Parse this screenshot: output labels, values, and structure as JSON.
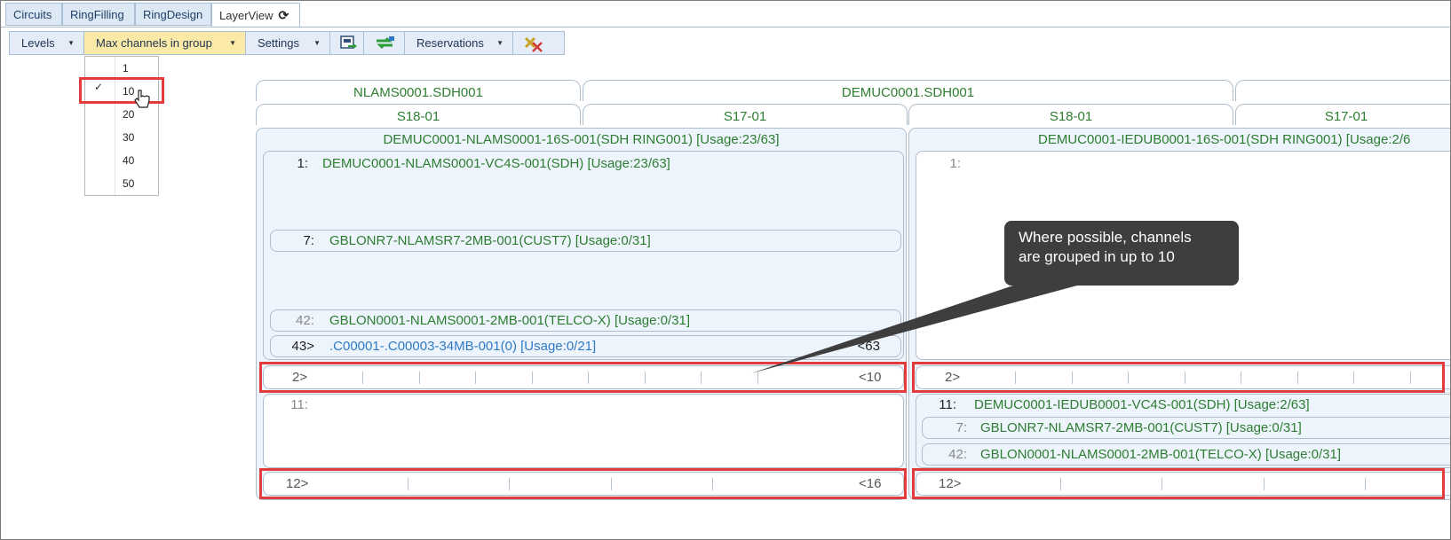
{
  "tabs": {
    "circuits": "Circuits",
    "ringfilling": "RingFilling",
    "ringdesign": "RingDesign",
    "layerview": "LayerView"
  },
  "toolbar": {
    "levels": "Levels",
    "max_channels": "Max channels in group",
    "settings": "Settings",
    "reservations": "Reservations"
  },
  "dropdown": {
    "options": [
      "1",
      "10",
      "20",
      "30",
      "40",
      "50"
    ],
    "selected": "10"
  },
  "headers": {
    "node1": "NLAMS0001.SDH001",
    "node2": "DEMUC0001.SDH001",
    "slot1": "S18-01",
    "slot2": "S17-01",
    "slot3": "S18-01",
    "slot4": "S17-01"
  },
  "group_left": {
    "title": "DEMUC0001-NLAMS0001-16S-001(SDH RING001) [Usage:23/63]",
    "vc_num": "1:",
    "vc_label": "DEMUC0001-NLAMS0001-VC4S-001(SDH) [Usage:23/63]",
    "row1_num": "7:",
    "row1_label": "GBLONR7-NLAMSR7-2MB-001(CUST7) [Usage:0/31]",
    "row2_num": "42:",
    "row2_label": "GBLON0001-NLAMS0001-2MB-001(TELCO-X) [Usage:0/31]",
    "row3_num": "43>",
    "row3_label": ".C00001-.C00003-34MB-001(0) [Usage:0/21]",
    "row3_end": "<63",
    "strip1_start": "2>",
    "strip1_end": "<10",
    "lower_num": "11:",
    "strip2_start": "12>",
    "strip2_end": "<16"
  },
  "group_right": {
    "title": "DEMUC0001-IEDUB0001-16S-001(SDH RING001) [Usage:2/6",
    "vc_num": "1:",
    "strip1_start": "2>",
    "vc2_num": "11:",
    "vc2_label": "DEMUC0001-IEDUB0001-VC4S-001(SDH) [Usage:2/63]",
    "row1_num": "7:",
    "row1_label": "GBLONR7-NLAMSR7-2MB-001(CUST7) [Usage:0/31]",
    "row2_num": "42:",
    "row2_label": "GBLON0001-NLAMS0001-2MB-001(TELCO-X) [Usage:0/31]",
    "strip2_start": "12>"
  },
  "callout": {
    "line1": "Where possible, channels",
    "line2": "are grouped in up to 10"
  },
  "colors": {
    "highlight_red": "#e23c3c",
    "label_green": "#2e7d32",
    "link_blue": "#2f7ac6",
    "callout_bg": "#3e3e3e"
  }
}
